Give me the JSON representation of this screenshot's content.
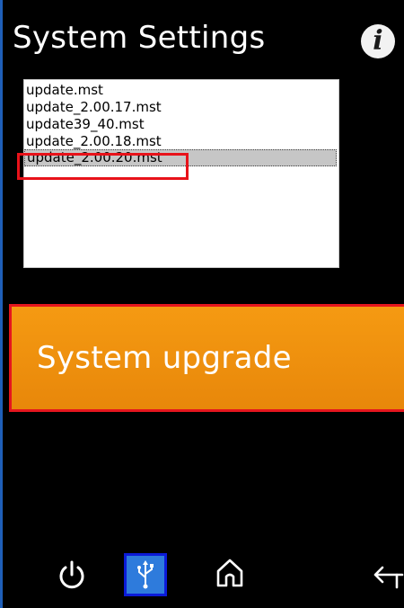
{
  "header": {
    "title": "System Settings",
    "info_icon": "info-icon"
  },
  "file_list": {
    "items": [
      {
        "label": "update.mst",
        "selected": false
      },
      {
        "label": "update_2.00.17.mst",
        "selected": false
      },
      {
        "label": "update39_40.mst",
        "selected": false
      },
      {
        "label": "update_2.00.18.mst",
        "selected": false
      },
      {
        "label": "update_2.00.20.mst",
        "selected": true
      }
    ]
  },
  "actions": {
    "upgrade_label": "System upgrade"
  },
  "bottom_bar": {
    "icons": [
      "power-icon",
      "usb-icon",
      "home-icon",
      "back-arrow-icon"
    ]
  },
  "colors": {
    "background": "#000000",
    "accent_orange": "#f59a12",
    "highlight_red": "#e5161e",
    "usb_blue": "#2e7bdc"
  }
}
